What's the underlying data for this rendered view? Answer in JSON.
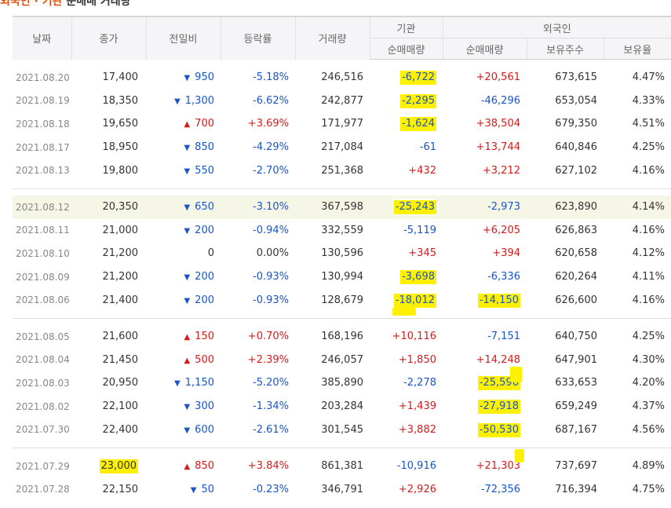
{
  "title": {
    "highlight": "외국인 · 기관",
    "rest": " 순매매 거래량"
  },
  "headers": {
    "date": "날짜",
    "close": "종가",
    "change": "전일비",
    "rate": "등락률",
    "volume": "거래량",
    "institution": "기관",
    "foreign": "외국인",
    "inst_net": "순매매량",
    "for_net": "순매매량",
    "holdings": "보유주수",
    "ratio": "보유율"
  },
  "rows": [
    {
      "date": "2021.08.20",
      "close": "17,400",
      "dir": "down",
      "change": "950",
      "rate": "-5.18%",
      "volume": "246,516",
      "inst": "-6,722",
      "foreign": "+20,561",
      "hold": "673,615",
      "ratio": "4.47%",
      "mark_inst": true
    },
    {
      "date": "2021.08.19",
      "close": "18,350",
      "dir": "down",
      "change": "1,300",
      "rate": "-6.62%",
      "volume": "242,877",
      "inst": "-2,295",
      "foreign": "-46,296",
      "hold": "653,054",
      "ratio": "4.33%",
      "mark_inst": true
    },
    {
      "date": "2021.08.18",
      "close": "19,650",
      "dir": "up",
      "change": "700",
      "rate": "+3.69%",
      "volume": "171,977",
      "inst": "-1,624",
      "foreign": "+38,504",
      "hold": "679,350",
      "ratio": "4.51%",
      "mark_inst": true
    },
    {
      "date": "2021.08.17",
      "close": "18,950",
      "dir": "down",
      "change": "850",
      "rate": "-4.29%",
      "volume": "217,084",
      "inst": "-61",
      "foreign": "+13,744",
      "hold": "640,846",
      "ratio": "4.25%"
    },
    {
      "date": "2021.08.13",
      "close": "19,800",
      "dir": "down",
      "change": "550",
      "rate": "-2.70%",
      "volume": "251,368",
      "inst": "+432",
      "foreign": "+3,212",
      "hold": "627,102",
      "ratio": "4.16%"
    },
    {
      "date": "2021.08.12",
      "close": "20,350",
      "dir": "down",
      "change": "650",
      "rate": "-3.10%",
      "volume": "367,598",
      "inst": "-25,243",
      "foreign": "-2,973",
      "hold": "623,890",
      "ratio": "4.14%",
      "mark_inst": true,
      "selected": true
    },
    {
      "date": "2021.08.11",
      "close": "21,000",
      "dir": "down",
      "change": "200",
      "rate": "-0.94%",
      "volume": "332,559",
      "inst": "-5,119",
      "foreign": "+6,205",
      "hold": "626,863",
      "ratio": "4.16%"
    },
    {
      "date": "2021.08.10",
      "close": "21,200",
      "dir": "flat",
      "change": "0",
      "rate": "0.00%",
      "volume": "130,596",
      "inst": "+345",
      "foreign": "+394",
      "hold": "620,658",
      "ratio": "4.12%"
    },
    {
      "date": "2021.08.09",
      "close": "21,200",
      "dir": "down",
      "change": "200",
      "rate": "-0.93%",
      "volume": "130,994",
      "inst": "-3,698",
      "foreign": "-6,336",
      "hold": "620,264",
      "ratio": "4.11%",
      "mark_inst": true
    },
    {
      "date": "2021.08.06",
      "close": "21,400",
      "dir": "down",
      "change": "200",
      "rate": "-0.93%",
      "volume": "128,679",
      "inst": "-18,012",
      "foreign": "-14,150",
      "hold": "626,600",
      "ratio": "4.16%",
      "mark_inst": true,
      "mark_for": true
    },
    {
      "date": "2021.08.05",
      "close": "21,600",
      "dir": "up",
      "change": "150",
      "rate": "+0.70%",
      "volume": "168,196",
      "inst": "+10,116",
      "foreign": "-7,151",
      "hold": "640,750",
      "ratio": "4.25%"
    },
    {
      "date": "2021.08.04",
      "close": "21,450",
      "dir": "up",
      "change": "500",
      "rate": "+2.39%",
      "volume": "246,057",
      "inst": "+1,850",
      "foreign": "+14,248",
      "hold": "647,901",
      "ratio": "4.30%"
    },
    {
      "date": "2021.08.03",
      "close": "20,950",
      "dir": "down",
      "change": "1,150",
      "rate": "-5.20%",
      "volume": "385,890",
      "inst": "-2,278",
      "foreign": "-25,596",
      "hold": "633,653",
      "ratio": "4.20%",
      "mark_for": true
    },
    {
      "date": "2021.08.02",
      "close": "22,100",
      "dir": "down",
      "change": "300",
      "rate": "-1.34%",
      "volume": "203,284",
      "inst": "+1,439",
      "foreign": "-27,918",
      "hold": "659,249",
      "ratio": "4.37%",
      "mark_for": true
    },
    {
      "date": "2021.07.30",
      "close": "22,400",
      "dir": "down",
      "change": "600",
      "rate": "-2.61%",
      "volume": "301,545",
      "inst": "+3,882",
      "foreign": "-50,530",
      "hold": "687,167",
      "ratio": "4.56%",
      "mark_for": true
    },
    {
      "date": "2021.07.29",
      "close": "23,000",
      "dir": "up",
      "change": "850",
      "rate": "+3.84%",
      "volume": "861,381",
      "inst": "-10,916",
      "foreign": "+21,303",
      "hold": "737,697",
      "ratio": "4.89%",
      "mark_close": true
    },
    {
      "date": "2021.07.28",
      "close": "22,150",
      "dir": "down",
      "change": "50",
      "rate": "-0.23%",
      "volume": "346,791",
      "inst": "+2,926",
      "foreign": "-72,356",
      "hold": "716,394",
      "ratio": "4.75%"
    }
  ],
  "groups": [
    5,
    5,
    5,
    2
  ],
  "colors": {
    "up": "#d7191b",
    "down": "#1955c9",
    "highlighter": "#fdf000",
    "title_accent": "#e7500c"
  },
  "icons": {
    "up": "▲",
    "down": "▼"
  }
}
